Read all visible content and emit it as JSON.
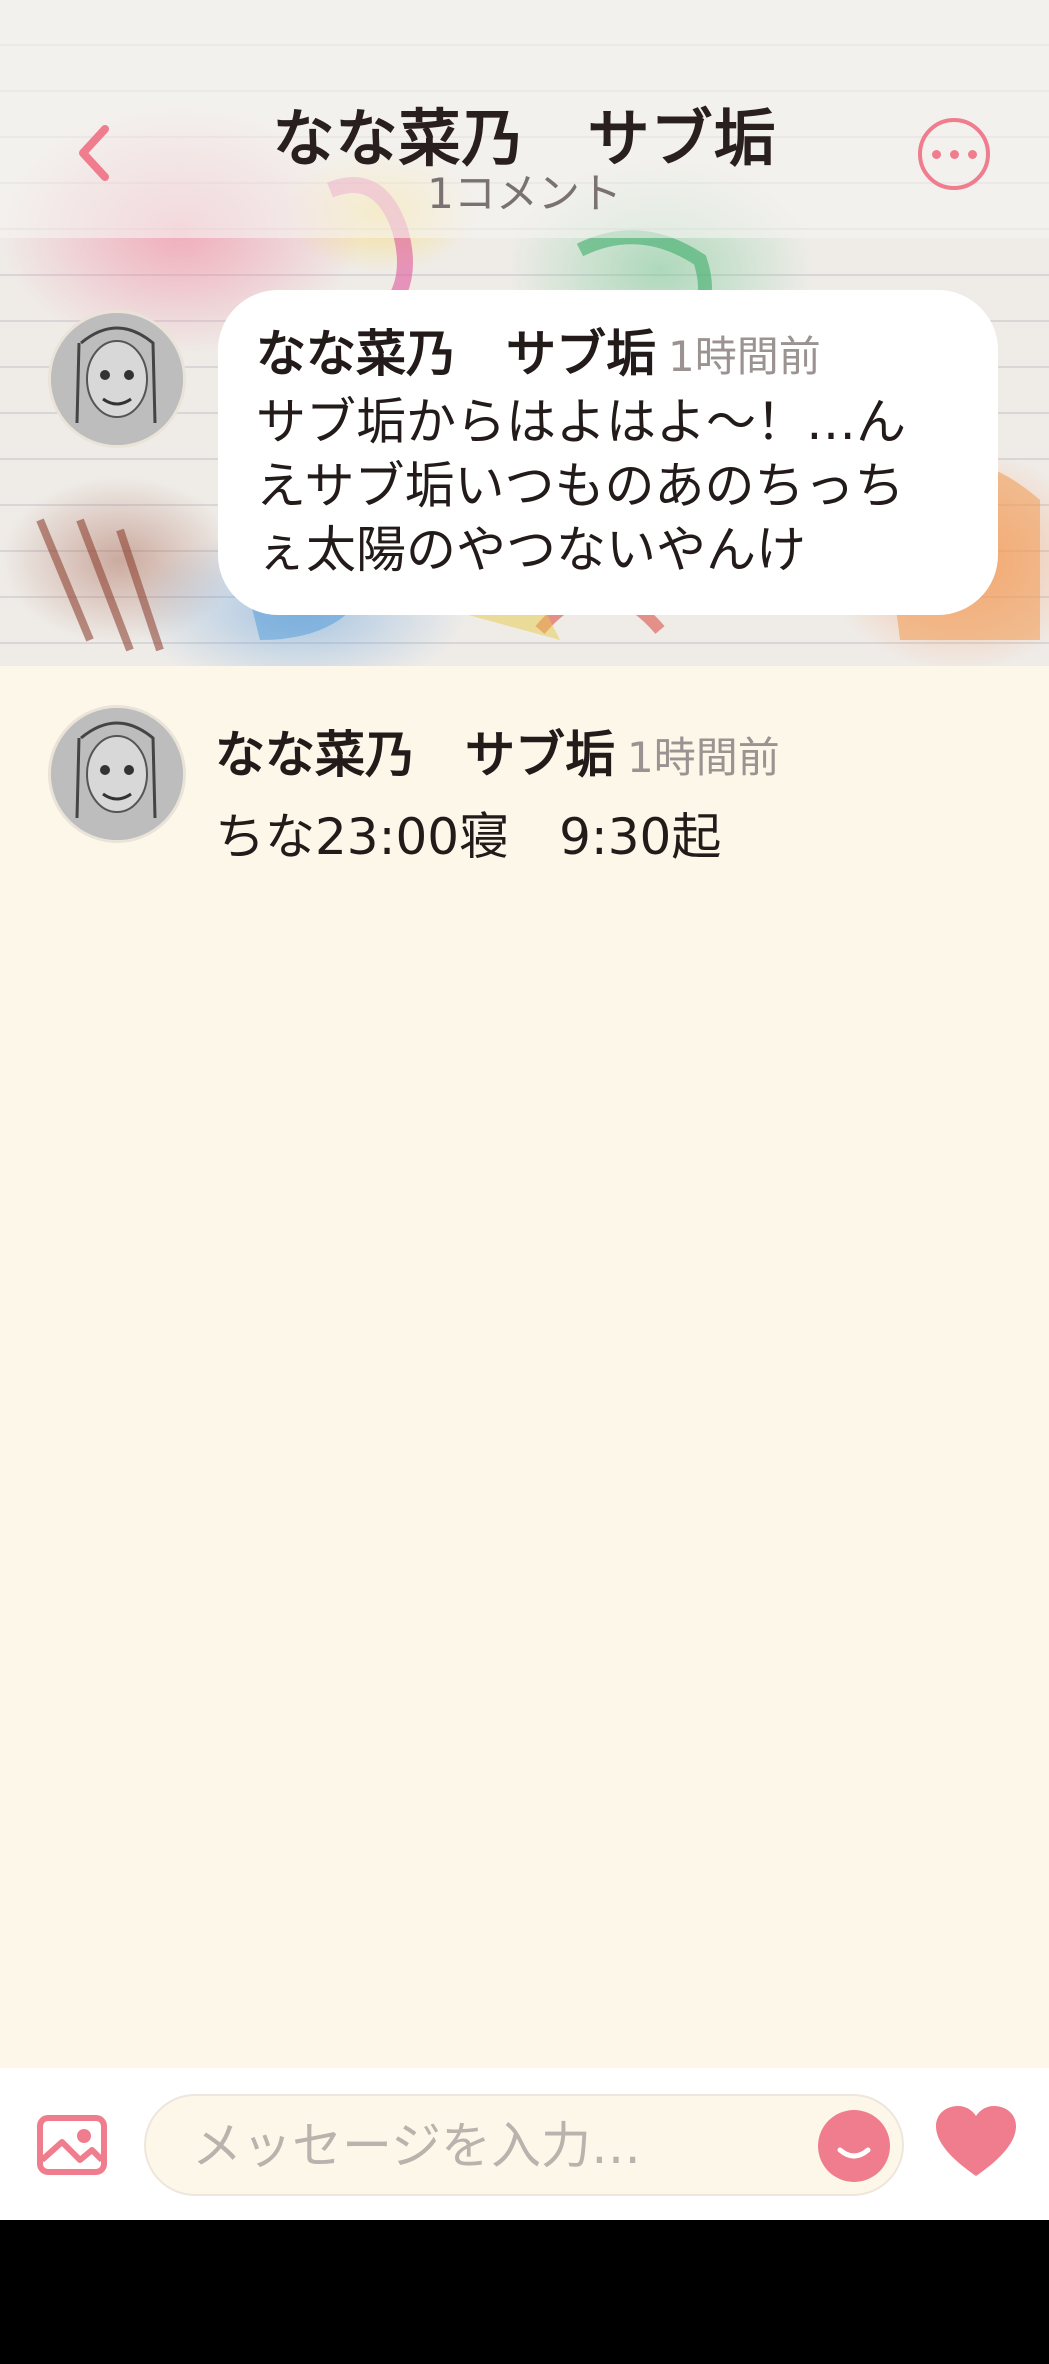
{
  "header": {
    "title": "なな菜乃　サブ垢",
    "subtitle": "1コメント"
  },
  "post": {
    "author": "なな菜乃　サブ垢",
    "time": "1時間前",
    "lines": [
      "サブ垢からはよはよ～！…ん",
      "えサブ垢いつものあのちっち",
      "ぇ太陽のやつないやんけ"
    ]
  },
  "comments": [
    {
      "author": "なな菜乃　サブ垢",
      "time": "1時間前",
      "text": "ちな23:00寝　9:30起"
    }
  ],
  "composer": {
    "placeholder": "メッセージを入力…"
  },
  "colors": {
    "accent": "#ef7d8d",
    "background": "#fdf7ea"
  }
}
